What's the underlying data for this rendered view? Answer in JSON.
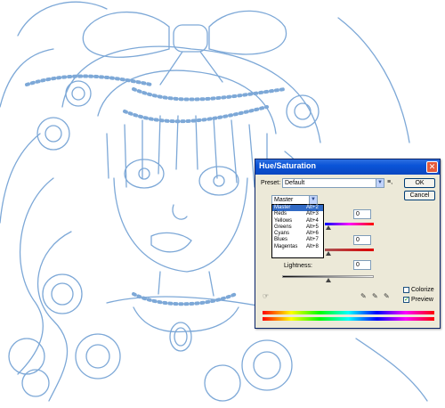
{
  "dialog": {
    "title": "Hue/Saturation",
    "close_glyph": "✕",
    "preset_label": "Preset:",
    "preset_value": "Default",
    "preset_menu_glyph": "≡,",
    "ok_label": "OK",
    "cancel_label": "Cancel",
    "channel_value": "Master",
    "hue_value": "0",
    "saturation_value": "0",
    "lightness_label": "Lightness:",
    "lightness_value": "0",
    "colorize_label": "Colorize",
    "preview_label": "Preview",
    "colorize_checked": false,
    "preview_checked": true,
    "channel_menu": [
      {
        "label": "Master",
        "shortcut": "Alt+2"
      },
      {
        "label": "Reds",
        "shortcut": "Alt+3"
      },
      {
        "label": "Yellows",
        "shortcut": "Alt+4"
      },
      {
        "label": "Greens",
        "shortcut": "Alt+5"
      },
      {
        "label": "Cyans",
        "shortcut": "Alt+6"
      },
      {
        "label": "Blues",
        "shortcut": "Alt+7"
      },
      {
        "label": "Magentas",
        "shortcut": "Alt+8"
      }
    ],
    "icons": {
      "hand_tool": "hand-icon",
      "eyedropper": "eyedropper-icon",
      "eyedropper_plus": "eyedropper-plus-icon",
      "eyedropper_minus": "eyedropper-minus-icon"
    }
  },
  "colors": {
    "sketch_line": "#6f9fd3",
    "title_bar": "#0a54d8",
    "selection": "#316ac5"
  }
}
